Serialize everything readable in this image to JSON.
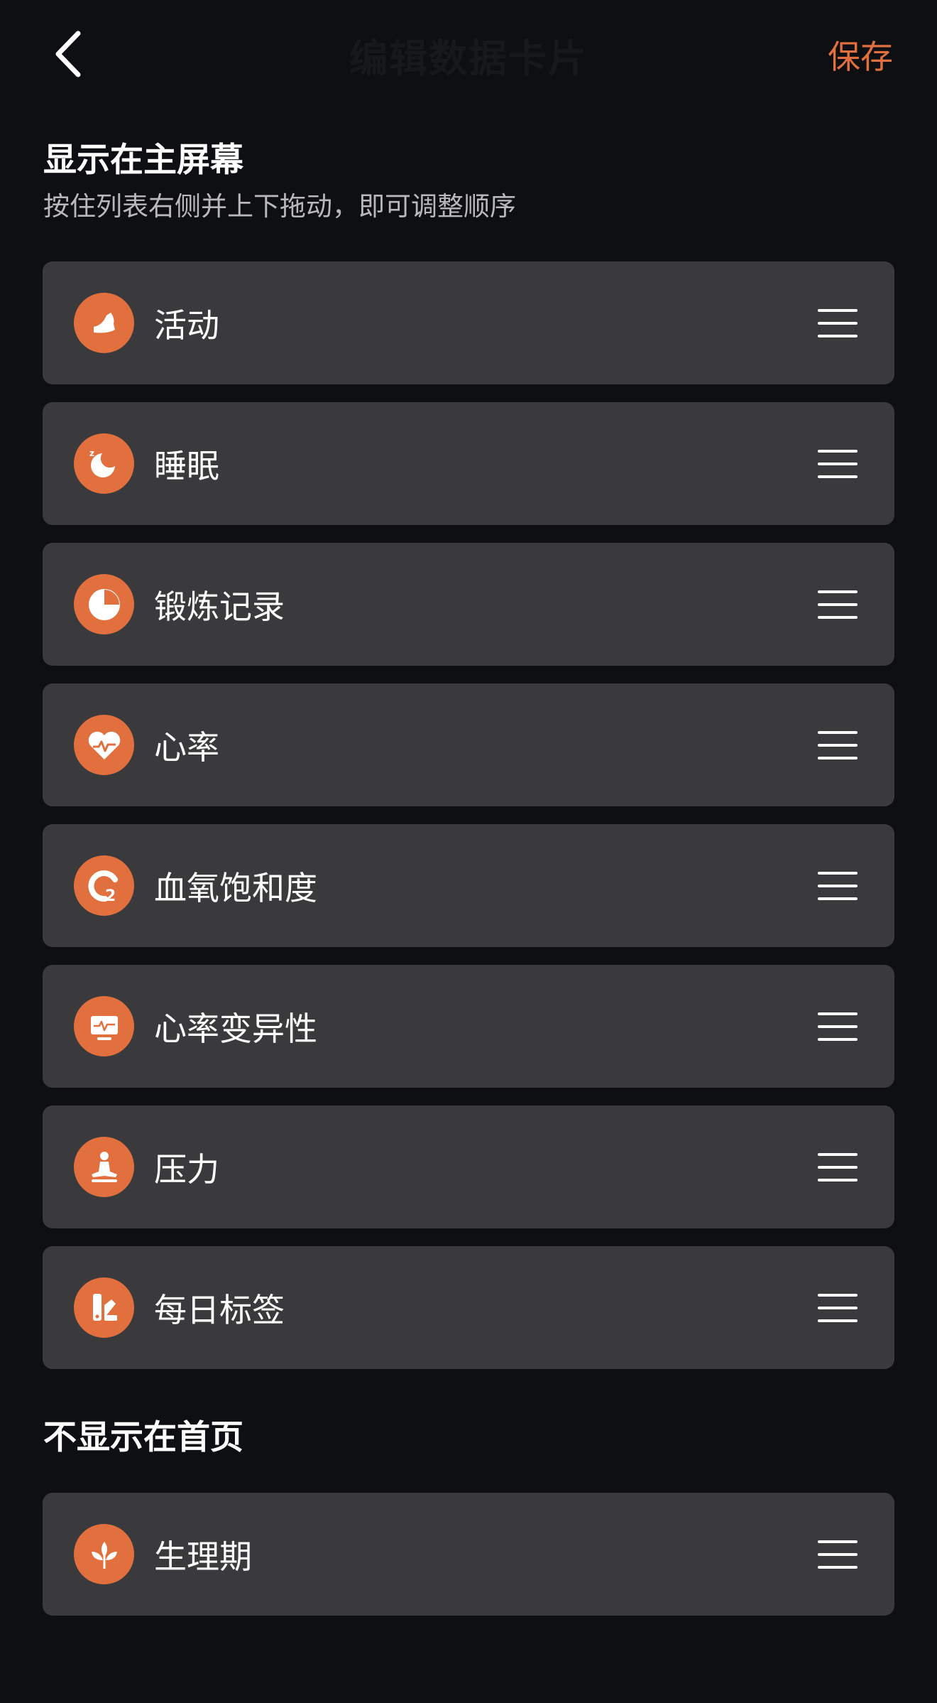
{
  "header": {
    "title": "编辑数据卡片",
    "save_label": "保存"
  },
  "shown_section": {
    "title": "显示在主屏幕",
    "subtitle": "按住列表右侧并上下拖动，即可调整顺序",
    "items": [
      {
        "label": "活动",
        "icon": "shoe-icon"
      },
      {
        "label": "睡眠",
        "icon": "moon-sleep-icon"
      },
      {
        "label": "锻炼记录",
        "icon": "pie-clock-icon"
      },
      {
        "label": "心率",
        "icon": "heart-pulse-icon"
      },
      {
        "label": "血氧饱和度",
        "icon": "o2-icon"
      },
      {
        "label": "心率变异性",
        "icon": "monitor-pulse-icon"
      },
      {
        "label": "压力",
        "icon": "meditation-icon"
      },
      {
        "label": "每日标签",
        "icon": "tag-icon"
      }
    ]
  },
  "hidden_section": {
    "title": "不显示在首页",
    "items": [
      {
        "label": "生理期",
        "icon": "leaf-icon"
      }
    ]
  },
  "colors": {
    "accent": "#e2703f",
    "card_bg": "#3a3a3c",
    "page_bg": "#0e0f12"
  }
}
